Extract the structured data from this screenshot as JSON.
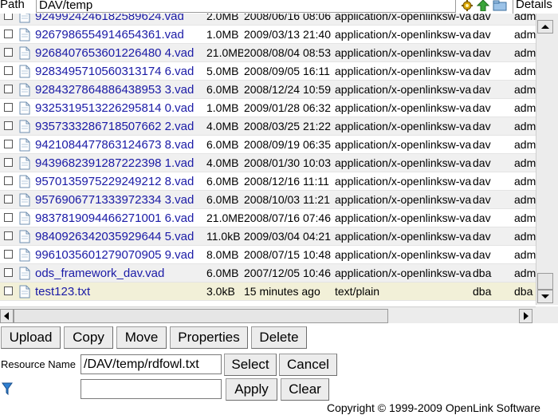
{
  "toolbar": {
    "path_label": "Path",
    "path_value": "DAV/temp",
    "details_label": "Details",
    "icons": [
      "gear-icon",
      "up-arrow-icon",
      "folder-icon"
    ]
  },
  "files": [
    {
      "name": "9249924246182589624.vad",
      "size": "2.0MB",
      "date": "2008/06/16 08:06",
      "type": "application/x-openlinksw-vad",
      "owner": "dav",
      "group": "adm"
    },
    {
      "name": "9267986554914654361.vad",
      "size": "1.0MB",
      "date": "2009/03/13 21:40",
      "type": "application/x-openlinksw-vad",
      "owner": "dav",
      "group": "adm"
    },
    {
      "name": "9268407653601226480 4.vad",
      "size": "21.0MB",
      "date": "2008/08/04 08:53",
      "type": "application/x-openlinksw-vad",
      "owner": "dav",
      "group": "adm"
    },
    {
      "name": "9283495710560313174 6.vad",
      "size": "5.0MB",
      "date": "2008/09/05 16:11",
      "type": "application/x-openlinksw-vad",
      "owner": "dav",
      "group": "adm"
    },
    {
      "name": "9284327864886438953 3.vad",
      "size": "6.0MB",
      "date": "2008/12/24 10:59",
      "type": "application/x-openlinksw-vad",
      "owner": "dav",
      "group": "adm"
    },
    {
      "name": "9325319513226295814 0.vad",
      "size": "1.0MB",
      "date": "2009/01/28 06:32",
      "type": "application/x-openlinksw-vad",
      "owner": "dav",
      "group": "adm"
    },
    {
      "name": "9357333286718507662 2.vad",
      "size": "4.0MB",
      "date": "2008/03/25 21:22",
      "type": "application/x-openlinksw-vad",
      "owner": "dav",
      "group": "adm"
    },
    {
      "name": "9421084477863124673 8.vad",
      "size": "6.0MB",
      "date": "2008/09/19 06:35",
      "type": "application/x-openlinksw-vad",
      "owner": "dav",
      "group": "adm"
    },
    {
      "name": "9439682391287222398 1.vad",
      "size": "4.0MB",
      "date": "2008/01/30 10:03",
      "type": "application/x-openlinksw-vad",
      "owner": "dav",
      "group": "adm"
    },
    {
      "name": "9570135975229249212 8.vad",
      "size": "6.0MB",
      "date": "2008/12/16 11:11",
      "type": "application/x-openlinksw-vad",
      "owner": "dav",
      "group": "adm"
    },
    {
      "name": "9576906771333972334 3.vad",
      "size": "6.0MB",
      "date": "2008/10/03 11:21",
      "type": "application/x-openlinksw-vad",
      "owner": "dav",
      "group": "adm"
    },
    {
      "name": "9837819094466271001 6.vad",
      "size": "21.0MB",
      "date": "2008/07/16 07:46",
      "type": "application/x-openlinksw-vad",
      "owner": "dav",
      "group": "adm"
    },
    {
      "name": "9840926342035929644 5.vad",
      "size": "11.0kB",
      "date": "2009/03/04 04:21",
      "type": "application/x-openlinksw-vad",
      "owner": "dav",
      "group": "adm"
    },
    {
      "name": "9961035601279070905 9.vad",
      "size": "8.0MB",
      "date": "2008/07/15 10:48",
      "type": "application/x-openlinksw-vad",
      "owner": "dav",
      "group": "adm"
    },
    {
      "name": "ods_framework_dav.vad",
      "size": "6.0MB",
      "date": "2007/12/05 10:46",
      "type": "application/x-openlinksw-vad",
      "owner": "dba",
      "group": "adm"
    },
    {
      "name": "test123.txt",
      "size": "3.0kB",
      "date": "15 minutes ago",
      "type": "text/plain",
      "owner": "dba",
      "group": "dba"
    }
  ],
  "actions": {
    "upload": "Upload",
    "copy": "Copy",
    "move": "Move",
    "properties": "Properties",
    "delete": "Delete"
  },
  "resource": {
    "label": "Resource Name",
    "value": "/DAV/temp/rdfowl.txt",
    "select": "Select",
    "cancel": "Cancel"
  },
  "filter": {
    "icon": "filter-icon",
    "value": "",
    "apply": "Apply",
    "clear": "Clear"
  },
  "footer": {
    "copyright": "Copyright © 1999-2009 OpenLink Software"
  },
  "colors": {
    "link": "#1a1aa6",
    "row_alt": "#f0f0f0",
    "row_selected": "#f2f0d8"
  }
}
